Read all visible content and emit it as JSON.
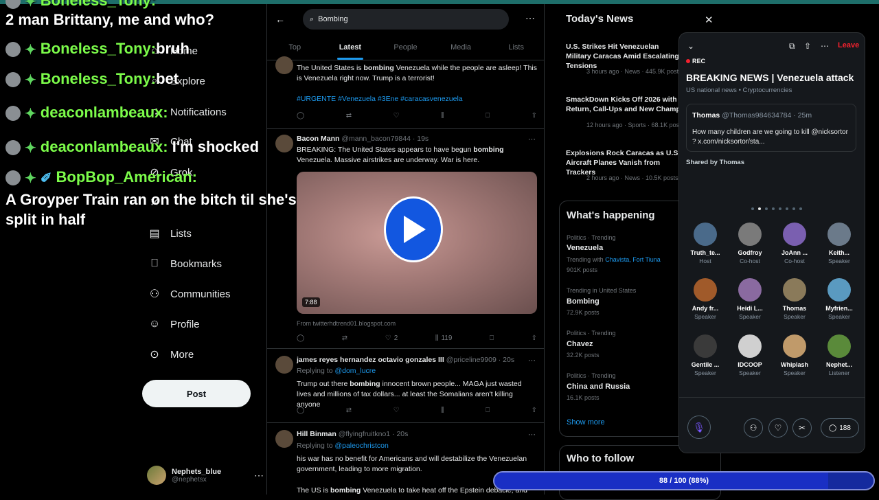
{
  "chat": {
    "lines": [
      {
        "user": "Boneless_Tony:",
        "msg": ""
      },
      {
        "user": "",
        "msg": "2 man Brittany, me and who?"
      },
      {
        "user": "Boneless_Tony:",
        "msg": "bruh"
      },
      {
        "user": "Boneless_Tony:",
        "msg": "bet"
      },
      {
        "user": "deaconlambeaux:",
        "msg": ""
      },
      {
        "user": "deaconlambeaux:",
        "msg": "I'm shocked"
      },
      {
        "user": "BopBop_American:",
        "msg": ""
      },
      {
        "user": "",
        "msg": "A Groyper Train ran on the bitch til she's"
      },
      {
        "user": "",
        "msg": "split in half"
      }
    ],
    "badge_icon": "gem-icon",
    "user_color": "#7cfc4a"
  },
  "nav": {
    "items": [
      {
        "label": "Home",
        "icon": "home-icon"
      },
      {
        "label": "Explore",
        "icon": "search-icon"
      },
      {
        "label": "Notifications",
        "icon": "bell-icon"
      },
      {
        "label": "Chat",
        "icon": "mail-icon"
      },
      {
        "label": "Grok",
        "icon": "grok-icon"
      },
      {
        "label": "",
        "icon": "x-logo-icon"
      },
      {
        "label": "Lists",
        "icon": "list-icon"
      },
      {
        "label": "Bookmarks",
        "icon": "bookmark-icon"
      },
      {
        "label": "Communities",
        "icon": "people-icon"
      },
      {
        "label": "Profile",
        "icon": "person-icon"
      },
      {
        "label": "More",
        "icon": "more-circle-icon"
      }
    ],
    "post_label": "Post",
    "account": {
      "name": "Nephets_blue",
      "handle": "@nephetsx"
    }
  },
  "search": {
    "value": "Bombing"
  },
  "tabs": [
    "Top",
    "Latest",
    "People",
    "Media",
    "Lists"
  ],
  "tweets": {
    "t1": {
      "text1": "The United States is ",
      "hl": "bombing",
      "text2": " Venezuela while the people are asleep! This is Venezuela right now. Trump is a terrorist!",
      "tags": "#URGENTE #Venezuela #3Ene #caracasvenezuela"
    },
    "t2": {
      "name": "Bacon Mann",
      "handle": "@mann_bacon79844 · 19s",
      "text1": "BREAKING: The United States appears to have begun ",
      "hl": "bombing",
      "text2": " Venezuela. Massive airstrikes are underway. War is here.",
      "duration": "7:88",
      "source": "From twitterhdtrend01.blogspot.com",
      "likes": "2",
      "views": "119"
    },
    "t3": {
      "name": "james reyes hernandez octavio gonzales III",
      "handle": "@priceline9909 · 20s",
      "replying": "Replying to ",
      "reply_handle": "@dom_lucre",
      "text1": "Trump out there ",
      "hl": "bombing",
      "text2": " innocent brown people... MAGA just wasted lives and millions of tax dollars... at least the Somalians aren't killing anyone"
    },
    "t4": {
      "name": "Hill Binman",
      "handle": "@flyingfruitkno1 · 20s",
      "replying": "Replying to ",
      "reply_handle": "@paleochristcon",
      "text": "his war has no benefit for Americans and will destabilize the Venezuelan government, leading to more migration.",
      "text_b1": "The US is ",
      "hl": "bombing",
      "text_b2": " Venezuela to take heat off the Epstein debacle, and"
    }
  },
  "news": {
    "title": "Today's News",
    "items": [
      {
        "headline": "U.S. Strikes Hit Venezuelan Military Caracas Amid Escalating Tensions",
        "meta": "3 hours ago · News · 445.9K posts"
      },
      {
        "headline": "SmackDown Kicks Off 2026 with Return, Call-Ups and New Champ",
        "meta": "12 hours ago · Sports · 68.1K posts"
      },
      {
        "headline": "Explosions Rock Caracas as U.S. Aircraft Planes Vanish from Trackers",
        "meta": "2 hours ago · News · 10.5K posts"
      }
    ]
  },
  "happening": {
    "title": "What's happening",
    "items": [
      {
        "cat": "Politics · Trending",
        "topic": "Venezuela",
        "sub": "Trending with ",
        "sub_link": "Chavista, Fort Tiuna",
        "posts": "901K posts"
      },
      {
        "cat": "Trending in United States",
        "topic": "Bombing",
        "sub": "",
        "sub_link": "",
        "posts": "72.9K posts"
      },
      {
        "cat": "Politics · Trending",
        "topic": "Chavez",
        "sub": "",
        "sub_link": "",
        "posts": "32.2K posts"
      },
      {
        "cat": "Politics · Trending",
        "topic": "China and Russia",
        "sub": "",
        "sub_link": "",
        "posts": "16.1K posts"
      }
    ],
    "show_more": "Show more"
  },
  "follow": {
    "title": "Who to follow"
  },
  "space": {
    "rec": "REC",
    "leave": "Leave",
    "title": "BREAKING NEWS | Venezuela attack",
    "subtitle": "US national news • Cryptocurrencies",
    "pinned": {
      "name": "Thomas",
      "handle": "@Thomas984634784 · 25m",
      "text": "How many children are we going to kill @nicksortor ? x.com/nicksortor/sta..."
    },
    "shared": "Shared by Thomas",
    "speakers": [
      {
        "name": "Truth_te...",
        "role": "Host"
      },
      {
        "name": "Godfroy",
        "role": "Co-host"
      },
      {
        "name": "JoAnn ...",
        "role": "Co-host"
      },
      {
        "name": "Keith...",
        "role": "Speaker"
      },
      {
        "name": "Andy fr...",
        "role": "Speaker"
      },
      {
        "name": "Heidi L...",
        "role": "Speaker"
      },
      {
        "name": "Thomas",
        "role": "Speaker"
      },
      {
        "name": "Myfrien...",
        "role": "Speaker"
      },
      {
        "name": "Gentile ...",
        "role": "Speaker"
      },
      {
        "name": "IDCOOP",
        "role": "Speaker"
      },
      {
        "name": "Whiplash",
        "role": "Speaker"
      },
      {
        "name": "Nephet...",
        "role": "Listener"
      }
    ],
    "chat_count": "188"
  },
  "progress": {
    "label": "88 / 100 (88%)",
    "fraction": 0.88
  },
  "colors": {
    "accent": "#1d9bf0",
    "bg": "#000000",
    "muted": "#71767b",
    "live_red": "#f4212e",
    "progress": "#1a2fc4"
  }
}
